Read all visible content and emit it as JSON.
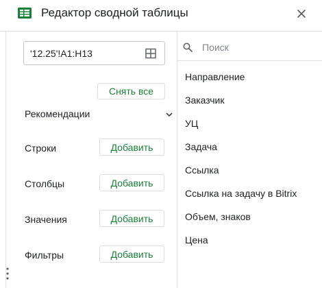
{
  "header": {
    "title": "Редактор сводной таблицы",
    "icon": "sheets-table-icon",
    "close_icon": "close-icon"
  },
  "range": {
    "value": "'12.25'!A1:H13",
    "icon": "grid-select-icon"
  },
  "clear_all_label": "Снять все",
  "recommendations_label": "Рекомендации",
  "sections": {
    "rows": {
      "label": "Строки",
      "add_label": "Добавить"
    },
    "columns": {
      "label": "Столбцы",
      "add_label": "Добавить"
    },
    "values": {
      "label": "Значения",
      "add_label": "Добавить"
    },
    "filters": {
      "label": "Фильтры",
      "add_label": "Добавить"
    }
  },
  "search": {
    "placeholder": "Поиск"
  },
  "fields": [
    "Направление",
    "Заказчик",
    "УЦ",
    "Задача",
    "Ссылка",
    "Ссылка на задачу в Bitrix",
    "Объем, знаков",
    "Цена"
  ],
  "colors": {
    "accent_green": "#188038",
    "sheets_green": "#188038",
    "border": "#dadce0"
  }
}
